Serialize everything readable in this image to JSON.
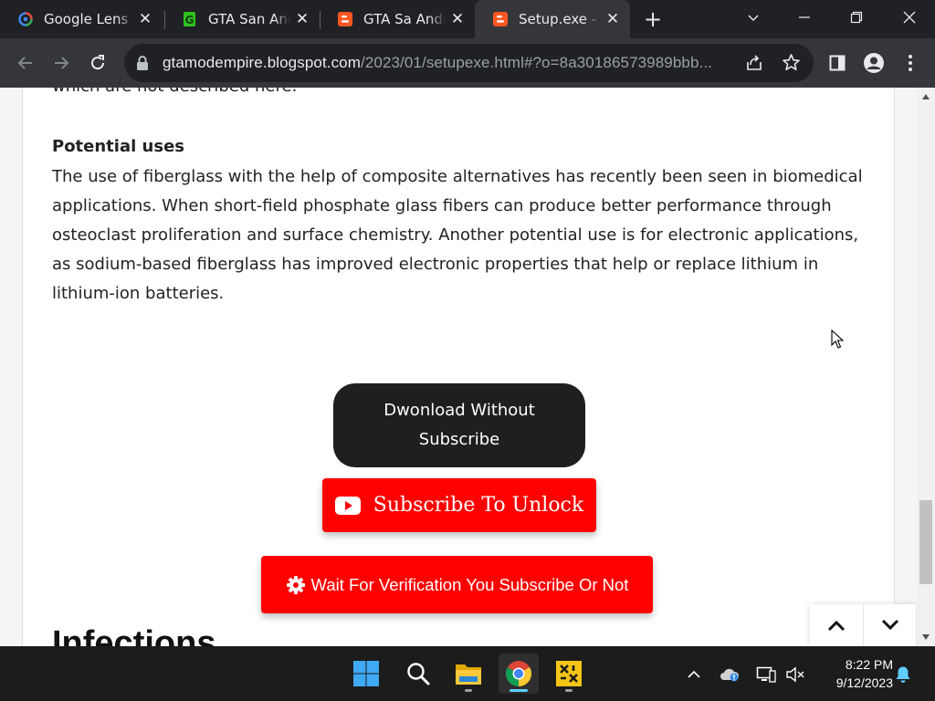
{
  "browser": {
    "tabs": [
      {
        "title": "Google Lens",
        "icon": "google-lens-icon",
        "active": false
      },
      {
        "title": "GTA San Andreas",
        "icon": "green-g-icon",
        "active": false
      },
      {
        "title": "GTA Sa Andreas",
        "icon": "blogger-icon",
        "active": false
      },
      {
        "title": "Setup.exe - GTA Mod Empire",
        "icon": "blogger-icon",
        "active": true
      }
    ],
    "address": {
      "host": "gtamodempire.blogspot.com",
      "path": "/2023/01/setupexe.html#?o=8a30186573989bbb..."
    }
  },
  "article": {
    "cut_line": "which are not described here.",
    "section_heading": "Potential uses",
    "paragraph": "The use of fiberglass with the help of composite alternatives has recently been seen in biomedical applications. When short-field phosphate glass fibers can produce better performance through osteoclast proliferation and surface chemistry. Another potential use is for electronic applications, as sodium-based fiberglass has improved electronic properties that help or replace lithium in lithium-ion batteries.",
    "next_heading": "Infections"
  },
  "buttons": {
    "download_line1": "Dwonload Without",
    "download_line2": "Subscribe",
    "subscribe_unlock": "Subscribe To Unlock",
    "wait_verification": "Wait For Verification You Subscribe Or Not"
  },
  "colors": {
    "accent_red": "#ff0000",
    "dark_button": "#1f1f1f",
    "browser_frame": "#202124"
  },
  "taskbar": {
    "apps": [
      "windows-start-icon",
      "search-icon",
      "file-explorer-icon",
      "chrome-icon",
      "yellow-app-icon"
    ],
    "time": "8:22 PM",
    "date": "9/12/2023"
  }
}
